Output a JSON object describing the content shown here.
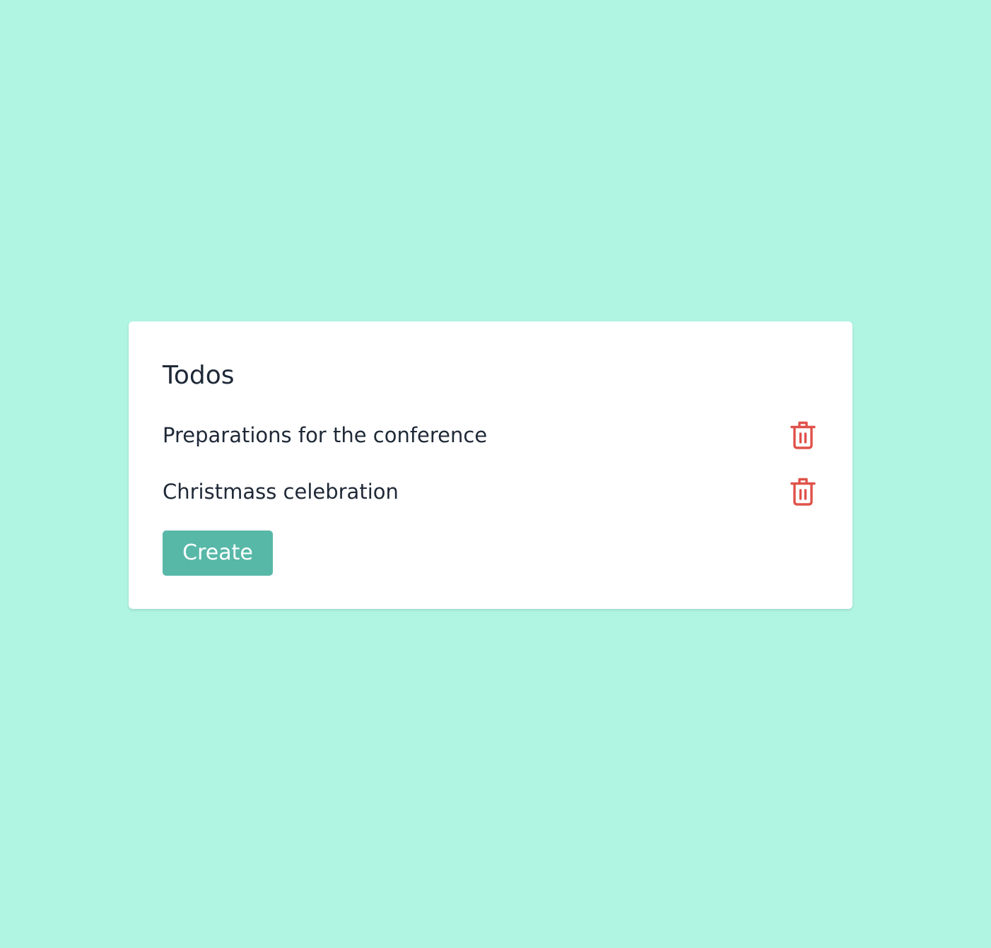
{
  "page": {
    "background_color": "#b0f4e2"
  },
  "card": {
    "title": "Todos",
    "background_color": "#ffffff",
    "todos": [
      {
        "text": "Preparations for the conference",
        "action_icon": "trash-icon"
      },
      {
        "text": "Christmass celebration",
        "action_icon": "trash-icon"
      }
    ],
    "create_button_label": "Create",
    "create_button_color": "#58b8a8",
    "delete_icon_color": "#e0524a",
    "text_color": "#1f2937"
  }
}
